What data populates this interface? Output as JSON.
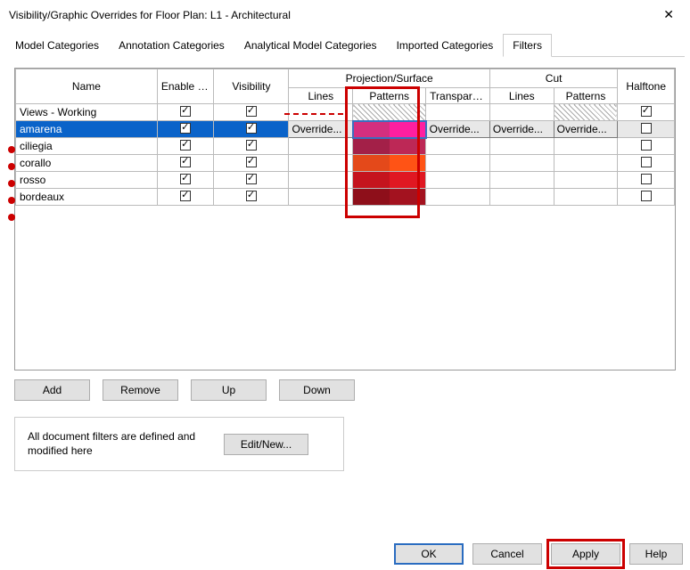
{
  "title": "Visibility/Graphic Overrides for Floor Plan: L1 - Architectural",
  "tabs": {
    "t0": "Model Categories",
    "t1": "Annotation Categories",
    "t2": "Analytical Model Categories",
    "t3": "Imported Categories",
    "t4": "Filters"
  },
  "headers": {
    "name": "Name",
    "enable": "Enable Filter",
    "visibility": "Visibility",
    "projection": "Projection/Surface",
    "cut": "Cut",
    "halftone": "Halftone",
    "lines": "Lines",
    "patterns": "Patterns",
    "transparency": "Transpare..."
  },
  "rows": {
    "r0": {
      "name": "Views - Working",
      "enable": true,
      "visibility": true,
      "halftone": true
    },
    "r1": {
      "name": "amarena",
      "enable": true,
      "visibility": true,
      "proj_lines": "Override...",
      "transparency": "Override...",
      "cut_lines": "Override...",
      "cut_patterns": "Override...",
      "halftone": false,
      "pat1": "#d42f7f",
      "pat2": "#ff1fa0"
    },
    "r2": {
      "name": "ciliegia",
      "enable": true,
      "visibility": true,
      "halftone": false,
      "pat1": "#a32048",
      "pat2": "#bd2856"
    },
    "r3": {
      "name": "corallo",
      "enable": true,
      "visibility": true,
      "halftone": false,
      "pat1": "#e4491a",
      "pat2": "#ff5315"
    },
    "r4": {
      "name": "rosso",
      "enable": true,
      "visibility": true,
      "halftone": false,
      "pat1": "#c5141e",
      "pat2": "#e01822"
    },
    "r5": {
      "name": "bordeaux",
      "enable": true,
      "visibility": true,
      "halftone": false,
      "pat1": "#8e0f1a",
      "pat2": "#a3121f"
    }
  },
  "buttons": {
    "add": "Add",
    "remove": "Remove",
    "up": "Up",
    "down": "Down",
    "editnew": "Edit/New...",
    "ok": "OK",
    "cancel": "Cancel",
    "apply": "Apply",
    "help": "Help"
  },
  "info_text": "All document filters are defined and modified here"
}
